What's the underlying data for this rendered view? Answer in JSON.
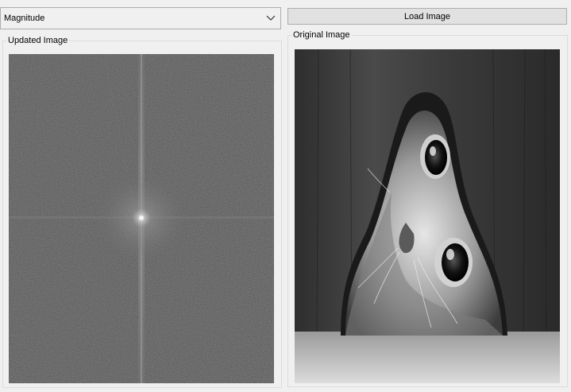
{
  "transform_select": {
    "value": "Magnitude",
    "icon": "chevron-down-icon"
  },
  "load_button": {
    "label": "Load Image"
  },
  "updated_panel": {
    "title": "Updated Image"
  },
  "original_panel": {
    "title": "Original Image"
  }
}
